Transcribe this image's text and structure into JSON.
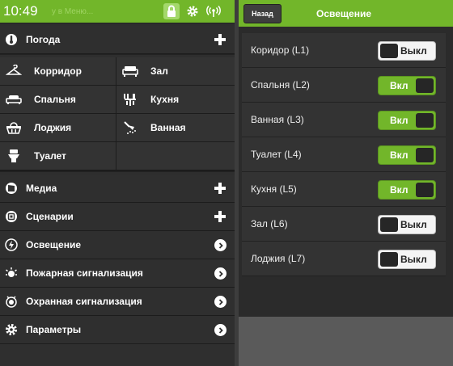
{
  "status_bar": {
    "time": "10:49",
    "ghost_text": "у  в Меню..."
  },
  "menu": {
    "weather": "Погода",
    "rooms": [
      {
        "label": "Корридор",
        "icon": "hanger-icon"
      },
      {
        "label": "Зал",
        "icon": "sofa-icon"
      },
      {
        "label": "Спальня",
        "icon": "bed-icon"
      },
      {
        "label": "Кухня",
        "icon": "kitchen-icon"
      },
      {
        "label": "Лоджия",
        "icon": "basket-icon"
      },
      {
        "label": "Ванная",
        "icon": "shower-icon"
      },
      {
        "label": "Туалет",
        "icon": "toilet-icon"
      }
    ],
    "media": "Медиа",
    "scenarios": "Сценарии",
    "lighting": "Освещение",
    "fire_alarm": "Пожарная сигнализация",
    "security_alarm": "Охранная сигнализация",
    "settings": "Параметры"
  },
  "lighting_panel": {
    "back_label": "Назад",
    "title": "Освещение",
    "on_label": "Вкл",
    "off_label": "Выкл",
    "items": [
      {
        "name": "Коридор (L1)",
        "state": "off"
      },
      {
        "name": "Спальня (L2)",
        "state": "on"
      },
      {
        "name": "Ванная (L3)",
        "state": "on"
      },
      {
        "name": "Туалет (L4)",
        "state": "on"
      },
      {
        "name": "Кухня (L5)",
        "state": "on"
      },
      {
        "name": "Зал (L6)",
        "state": "off"
      },
      {
        "name": "Лоджия (L7)",
        "state": "off"
      }
    ]
  },
  "colors": {
    "accent": "#72b62a",
    "panel": "#2e2e2e",
    "background": "#5a5a5a"
  }
}
